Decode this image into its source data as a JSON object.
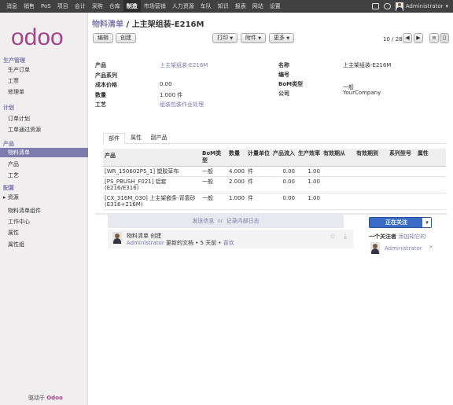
{
  "topbar": {
    "menu": [
      "消息",
      "销售",
      "PoS",
      "项目",
      "会计",
      "采购",
      "仓库",
      "制造",
      "市场营销",
      "人力资源",
      "车队",
      "知识",
      "报表",
      "网站",
      "设置"
    ],
    "active_index": 7,
    "user": "Administrator"
  },
  "sidebar": {
    "logo_text": "odoo",
    "sections": [
      {
        "title": "生产管理",
        "items": [
          "生产订单",
          "工票",
          "修理单"
        ]
      },
      {
        "title": "计划",
        "items": [
          "订单计划",
          "工单通过资源"
        ]
      },
      {
        "title": "产品",
        "items": [
          "物料清单",
          "产品",
          "工艺"
        ]
      },
      {
        "title": "配置",
        "items": [
          "资源",
          "物料清单组件",
          "工作中心",
          "属性",
          "属性组"
        ]
      }
    ],
    "selected_item": "物料清单",
    "powered_by_label": "驱动于",
    "powered_by_brand": "Odoo"
  },
  "breadcrumb": {
    "parent": "物料清单",
    "separator": " / ",
    "current": "上主架组装-E216M"
  },
  "buttons": {
    "edit": "编辑",
    "create": "创建",
    "print": "打印",
    "attachment": "附件",
    "more": "更多"
  },
  "pager": {
    "text": "10 / 28"
  },
  "form": {
    "left": [
      {
        "label": "产品",
        "value": "上主架组装-E216M",
        "link": true
      },
      {
        "label": "产品系列",
        "value": ""
      },
      {
        "label": "成本价格",
        "value": "0.00"
      },
      {
        "label": "数量",
        "value": "1.000 件"
      },
      {
        "label": "工艺",
        "value": "组装包装作业处理",
        "link": true
      }
    ],
    "right": [
      {
        "label": "名称",
        "value": "上主架组装-E216M"
      },
      {
        "label": "编号",
        "value": ""
      },
      {
        "label": "BoM类型",
        "value": "一般"
      },
      {
        "label": "公司",
        "value": "YourCompany"
      }
    ]
  },
  "tabs": [
    "部件",
    "属性",
    "副产品"
  ],
  "table": {
    "headers": [
      "产品",
      "BoM类型",
      "数量",
      "计量单位",
      "产品流入",
      "生产效率",
      "有效期从",
      "有效期到",
      "系列型号",
      "属性"
    ],
    "rows": [
      [
        "[WR_150602P5_1] 塑胶草布",
        "一般",
        "4.000",
        "件",
        "0.00",
        "1.00",
        "",
        "",
        "",
        ""
      ],
      [
        "[PS_PBUSH_F021] 铝套(E216/E316)",
        "一般",
        "2.000",
        "件",
        "0.00",
        "1.00",
        "",
        "",
        "",
        ""
      ],
      [
        "[CX_316M_030] 上主架嵌条-背靠砂(E316+216M)",
        "一般",
        "1.000",
        "件",
        "0.00",
        "1.00",
        "",
        "",
        "",
        ""
      ]
    ]
  },
  "chatter": {
    "send_message": "发送信息",
    "or": "or",
    "log_note": "记录内部日志",
    "message": {
      "author_line": "物料清单 创建",
      "author": "Administrator",
      "text": " 更新的文档 • 5 天前 • ",
      "like": "喜欢"
    },
    "follow_button": "正在关注",
    "followers_count": "一个关注者",
    "add_followers": "添加知它的",
    "follower_name": "Administrator"
  }
}
